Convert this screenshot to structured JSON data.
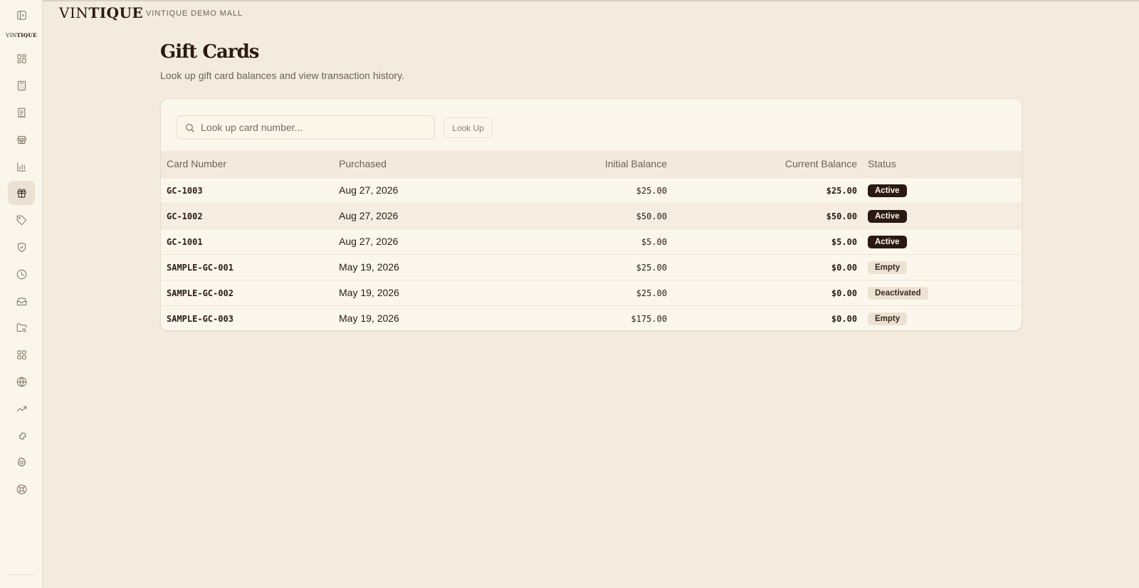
{
  "brand": {
    "logo": "VINTIQUE",
    "logo_light": "VIN",
    "logo_bold": "TIQUE",
    "mall_name": "VINTIQUE DEMO MALL"
  },
  "sidebar": {
    "mini_logo_light": "VIN",
    "mini_logo_bold": "TIQUE",
    "items": [
      {
        "name": "dashboard",
        "icon": "layout-dashboard-icon"
      },
      {
        "name": "register",
        "icon": "calculator-icon"
      },
      {
        "name": "orders",
        "icon": "receipt-icon"
      },
      {
        "name": "stores",
        "icon": "store-icon"
      },
      {
        "name": "reports",
        "icon": "bar-chart-icon"
      },
      {
        "name": "gift-cards",
        "icon": "gift-icon",
        "active": true
      },
      {
        "name": "tags",
        "icon": "tag-icon"
      },
      {
        "name": "security",
        "icon": "shield-check-icon"
      },
      {
        "name": "history",
        "icon": "clock-icon"
      },
      {
        "name": "inbox",
        "icon": "inbox-icon"
      },
      {
        "name": "folders",
        "icon": "folder-search-icon"
      },
      {
        "name": "apps",
        "icon": "grid-icon"
      },
      {
        "name": "web",
        "icon": "globe-icon"
      },
      {
        "name": "trends",
        "icon": "trending-up-icon"
      },
      {
        "name": "integrations",
        "icon": "puzzle-icon"
      },
      {
        "name": "settings",
        "icon": "gear-icon"
      },
      {
        "name": "support",
        "icon": "lifebuoy-icon"
      }
    ]
  },
  "page": {
    "title": "Gift Cards",
    "subtitle": "Look up gift card balances and view transaction history."
  },
  "search": {
    "placeholder": "Look up card number...",
    "value": "",
    "button_label": "Look Up"
  },
  "table": {
    "headers": [
      "Card Number",
      "Purchased",
      "Initial Balance",
      "Current Balance",
      "Status"
    ],
    "rows": [
      {
        "card": "GC-1003",
        "purchased": "Aug 27, 2026",
        "initial": "$25.00",
        "current": "$25.00",
        "status": "Active"
      },
      {
        "card": "GC-1002",
        "purchased": "Aug 27, 2026",
        "initial": "$50.00",
        "current": "$50.00",
        "status": "Active"
      },
      {
        "card": "GC-1001",
        "purchased": "Aug 27, 2026",
        "initial": "$5.00",
        "current": "$5.00",
        "status": "Active"
      },
      {
        "card": "SAMPLE-GC-001",
        "purchased": "May 19, 2026",
        "initial": "$25.00",
        "current": "$0.00",
        "status": "Empty"
      },
      {
        "card": "SAMPLE-GC-002",
        "purchased": "May 19, 2026",
        "initial": "$25.00",
        "current": "$0.00",
        "status": "Deactivated"
      },
      {
        "card": "SAMPLE-GC-003",
        "purchased": "May 19, 2026",
        "initial": "$175.00",
        "current": "$0.00",
        "status": "Empty"
      }
    ]
  },
  "colors": {
    "background": "#f3ebdd",
    "accent": "#2b1a12",
    "card": "#fcf7ec",
    "badge_muted": "#ece2d3"
  }
}
